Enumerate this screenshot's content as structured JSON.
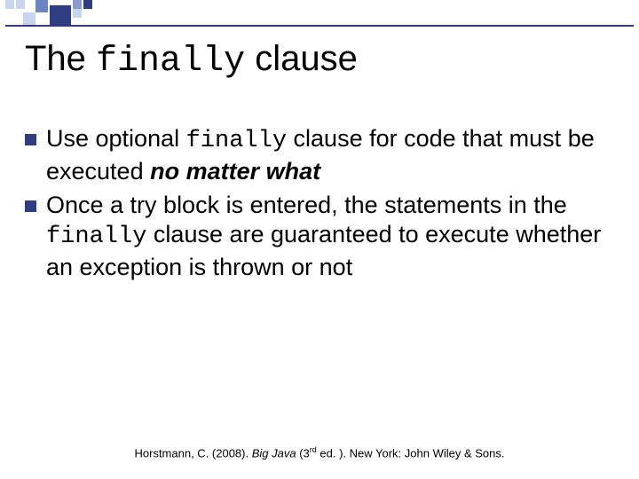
{
  "title": {
    "pre": "The ",
    "mono": "finally",
    "post": " clause"
  },
  "bullets": [
    {
      "p1": "Use optional ",
      "mono": "finally",
      "p2": " clause for code that must be executed ",
      "emph": "no matter what"
    },
    {
      "p1": "Once a try block is entered, the statements in the ",
      "mono": "finally",
      "p2": " clause are guaranteed to execute whether an exception is thrown or not",
      "emph": ""
    }
  ],
  "citation": {
    "author": "Horstmann, C. (2008). ",
    "book": "Big Java",
    "edition_open": " (3",
    "edition_sup": "rd",
    "edition_close": " ed. ). New York: John Wiley & Sons."
  }
}
